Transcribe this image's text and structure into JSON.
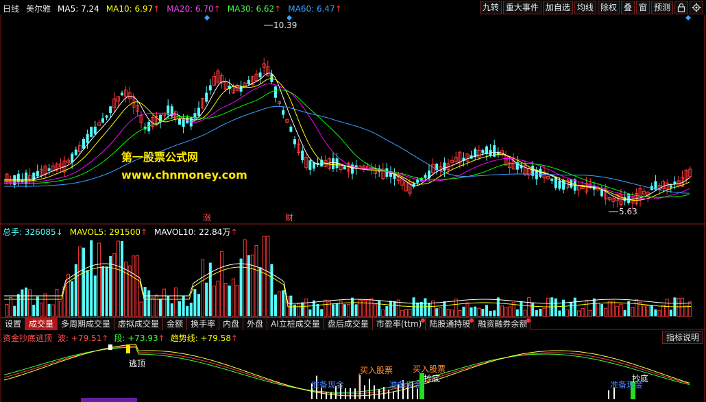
{
  "header": {
    "period": "日线",
    "stock_name": "美尔雅",
    "ma5": "MA5: 7.24",
    "ma10": "MA10: 6.97",
    "ma20": "MA20: 6.70",
    "ma30": "MA30: 6.62",
    "ma60": "MA60: 6.47",
    "up_arrow": "↑"
  },
  "toolbar": {
    "nine_turn": "九转",
    "major_events": "重大事件",
    "add_watch": "加自选",
    "average_line": "均线",
    "ex_rights": "除权",
    "overlay": "叠",
    "window": "窗",
    "forecast": "预测"
  },
  "price_chart": {
    "high_label": "10.39",
    "low_label": "5.63",
    "mark_zhang": "涨",
    "mark_cai": "财"
  },
  "watermark": {
    "line1": "第一股票公式网",
    "line2": "www.chnmoney.com"
  },
  "volume": {
    "total_hands": "总手: 326085",
    "down_arrow": "↓",
    "mavol5": "MAVOL5: 291500",
    "mavol10": "MAVOL10: 22.84万",
    "up_arrow": "↑"
  },
  "tabs": [
    {
      "label": "设置"
    },
    {
      "label": "成交量"
    },
    {
      "label": "多周期成交量"
    },
    {
      "label": "虚拟成交量"
    },
    {
      "label": "金额"
    },
    {
      "label": "换手率"
    },
    {
      "label": "内盘"
    },
    {
      "label": "外盘"
    },
    {
      "label": "AI立桩成交量"
    },
    {
      "label": "盘后成交量"
    },
    {
      "label": "市盈率(ttm)"
    },
    {
      "label": "陆股通持股"
    },
    {
      "label": "融资融券余额"
    }
  ],
  "indicator": {
    "name": "资金抄底逃顶",
    "wave": "波: +79.51",
    "segment": "段: +73.93",
    "trend": "趋势线: +79.58",
    "up_arrow": "↑",
    "explain_button": "指标说明",
    "label_escape": "逃顶",
    "label_prepare_1": "准备现金",
    "label_buy_1": "买入股票",
    "label_prepare_2": "准备现金",
    "label_buy_2": "买入股票",
    "label_bottom_1": "抄底",
    "label_prepare_3": "准备现金",
    "label_bottom_2": "抄底"
  },
  "colors": {
    "up": "#ff3a3a",
    "down": "#54ffff",
    "ma5": "#ffffff",
    "ma10": "#ffff00",
    "ma20": "#ff00ff",
    "ma30": "#00ff00",
    "ma60": "#40a0ff",
    "frame": "#8b1a1a"
  },
  "icons": {
    "lock": "lock-icon",
    "settings": "gear-icon"
  }
}
